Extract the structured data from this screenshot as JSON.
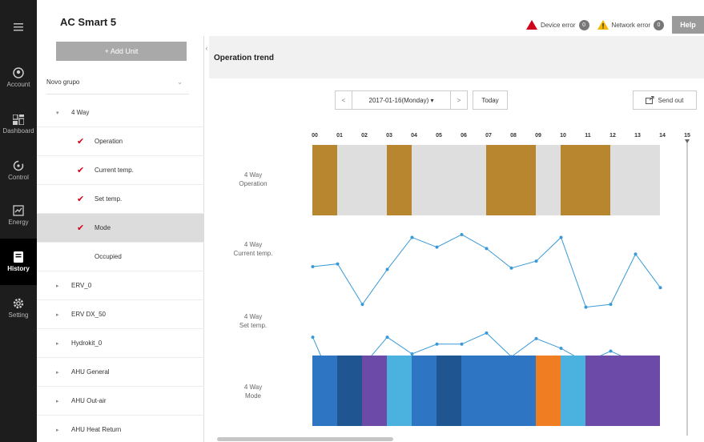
{
  "app": {
    "title": "AC Smart 5"
  },
  "header": {
    "device_error_label": "Device error",
    "device_error_count": "0",
    "network_error_label": "Network error",
    "network_error_count": "0",
    "help_label": "Help"
  },
  "nav": {
    "menu_icon": "hamburger-icon",
    "items": [
      {
        "label": "Account",
        "icon": "account-icon"
      },
      {
        "label": "Dashboard",
        "icon": "dashboard-icon"
      },
      {
        "label": "Control",
        "icon": "control-icon"
      },
      {
        "label": "Energy",
        "icon": "energy-icon"
      },
      {
        "label": "History",
        "icon": "history-icon",
        "active": true
      },
      {
        "label": "Setting",
        "icon": "setting-icon"
      }
    ]
  },
  "tree": {
    "add_unit_label": "+ Add Unit",
    "group_label": "Novo grupo",
    "rows": [
      {
        "label": "4 Way",
        "arrow": "▾"
      },
      {
        "label": "Operation",
        "checked": true
      },
      {
        "label": "Current temp.",
        "checked": true
      },
      {
        "label": "Set temp.",
        "checked": true
      },
      {
        "label": "Mode",
        "checked": true,
        "selected": true
      },
      {
        "label": "Occupied",
        "checked": false
      },
      {
        "label": "ERV_0",
        "arrow": "▸"
      },
      {
        "label": "ERV DX_50",
        "arrow": "▸"
      },
      {
        "label": "Hydrokit_0",
        "arrow": "▸"
      },
      {
        "label": "AHU General",
        "arrow": "▸"
      },
      {
        "label": "AHU Out-air",
        "arrow": "▸"
      },
      {
        "label": "AHU Heat Return",
        "arrow": "▸"
      }
    ]
  },
  "main": {
    "title": "Operation trend",
    "prev_label": "<",
    "date_label": "2017-01-16(Monday) ▾",
    "next_label": ">",
    "today_label": "Today",
    "send_out_label": "Send out",
    "row_labels": [
      [
        "4 Way",
        "Operation"
      ],
      [
        "4 Way",
        "Current temp."
      ],
      [
        "4 Way",
        "Set temp."
      ],
      [
        "4 Way",
        "Mode"
      ]
    ]
  },
  "chart_data": {
    "type": "timeline",
    "hours": [
      "00",
      "01",
      "02",
      "03",
      "04",
      "05",
      "06",
      "07",
      "08",
      "09",
      "10",
      "11",
      "12",
      "13",
      "14",
      "15"
    ],
    "current_hour_marker": 15,
    "operation": {
      "on_color": "#b8862f",
      "off_color": "#dedede",
      "segments": [
        {
          "start": 0,
          "end": 1,
          "state": "on"
        },
        {
          "start": 1,
          "end": 3,
          "state": "off"
        },
        {
          "start": 3,
          "end": 4,
          "state": "on"
        },
        {
          "start": 4,
          "end": 7,
          "state": "off"
        },
        {
          "start": 7,
          "end": 9,
          "state": "on"
        },
        {
          "start": 9,
          "end": 10,
          "state": "off"
        },
        {
          "start": 10,
          "end": 12,
          "state": "on"
        },
        {
          "start": 12,
          "end": 14,
          "state": "off"
        }
      ]
    },
    "current_temp": {
      "color": "#3a9ad9",
      "x": [
        0.5,
        1.5,
        2.5,
        3.5,
        4.5,
        5.5,
        6.5,
        7.5,
        8.5,
        9.5,
        10.5,
        11.5,
        12.5,
        13.5,
        14.5
      ],
      "y": [
        6.3,
        6.5,
        3.6,
        6.1,
        8.4,
        7.7,
        8.6,
        7.6,
        6.2,
        6.7,
        8.4,
        3.4,
        3.6,
        7.2,
        4.8
      ]
    },
    "set_temp": {
      "color": "#3a9ad9",
      "x": [
        0.5,
        1.5,
        2.5,
        3.5,
        4.5,
        5.5,
        6.5,
        7.5,
        8.5,
        9.5,
        10.5,
        11.5,
        12.5,
        13.5
      ],
      "y": [
        6.7,
        2.6,
        4.6,
        6.7,
        5.5,
        6.2,
        6.2,
        7.0,
        5.3,
        6.6,
        5.9,
        4.9,
        5.7,
        4.9
      ]
    },
    "mode": {
      "colors": {
        "cool": "#2e75c4",
        "dark": "#1f5590",
        "purple": "#6b4aa8",
        "light": "#4bb2e0",
        "heat": "#f07d22"
      },
      "segments": [
        {
          "start": 0,
          "end": 1,
          "mode": "cool"
        },
        {
          "start": 1,
          "end": 2,
          "mode": "dark"
        },
        {
          "start": 2,
          "end": 3,
          "mode": "purple"
        },
        {
          "start": 3,
          "end": 4,
          "mode": "light"
        },
        {
          "start": 4,
          "end": 5,
          "mode": "cool"
        },
        {
          "start": 5,
          "end": 6,
          "mode": "dark"
        },
        {
          "start": 6,
          "end": 7,
          "mode": "cool"
        },
        {
          "start": 7,
          "end": 9,
          "mode": "cool"
        },
        {
          "start": 9,
          "end": 10,
          "mode": "heat"
        },
        {
          "start": 10,
          "end": 11,
          "mode": "light"
        },
        {
          "start": 11,
          "end": 12,
          "mode": "purple"
        },
        {
          "start": 12,
          "end": 14,
          "mode": "purple"
        }
      ]
    }
  }
}
